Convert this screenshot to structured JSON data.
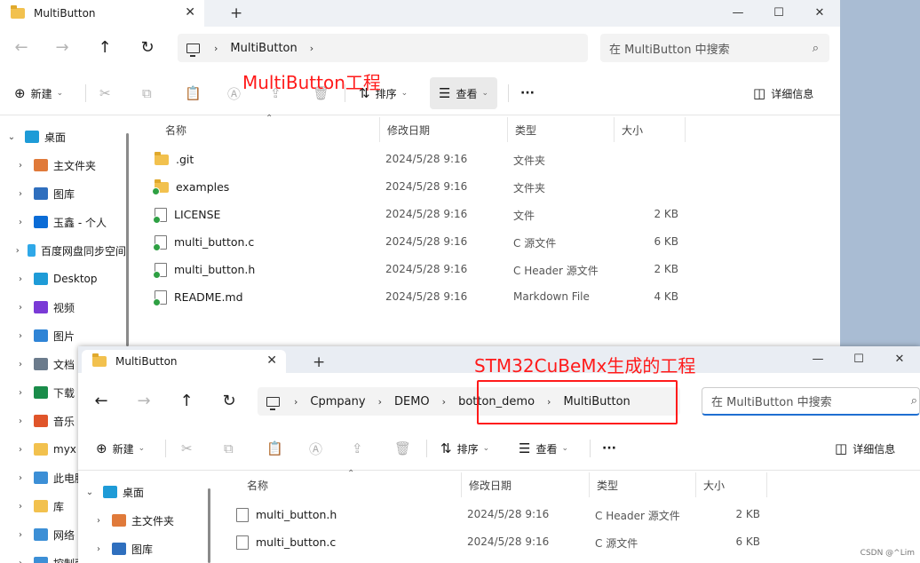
{
  "window1": {
    "tab_title": "MultiButton",
    "nav": {
      "back": "←",
      "forward": "→",
      "up": "↑",
      "refresh": "↻"
    },
    "address": {
      "crumbs": [
        "MultiButton"
      ],
      "trailing_chevron": "›"
    },
    "search_placeholder": "在 MultiButton 中搜索",
    "toolbar": {
      "new_label": "新建",
      "sort_label": "排序",
      "view_label": "查看",
      "more_label": "···",
      "details_label": "详细信息"
    },
    "columns": {
      "name": "名称",
      "date": "修改日期",
      "type": "类型",
      "size": "大小"
    },
    "files": [
      {
        "name": ".git",
        "date": "2024/5/28 9:16",
        "type": "文件夹",
        "size": "",
        "kind": "folder",
        "synced": false
      },
      {
        "name": "examples",
        "date": "2024/5/28 9:16",
        "type": "文件夹",
        "size": "",
        "kind": "folder",
        "synced": true
      },
      {
        "name": "LICENSE",
        "date": "2024/5/28 9:16",
        "type": "文件",
        "size": "2 KB",
        "kind": "file",
        "synced": true
      },
      {
        "name": "multi_button.c",
        "date": "2024/5/28 9:16",
        "type": "C 源文件",
        "size": "6 KB",
        "kind": "file",
        "synced": true
      },
      {
        "name": "multi_button.h",
        "date": "2024/5/28 9:16",
        "type": "C Header 源文件",
        "size": "2 KB",
        "kind": "file",
        "synced": true
      },
      {
        "name": "README.md",
        "date": "2024/5/28 9:16",
        "type": "Markdown File",
        "size": "4 KB",
        "kind": "file",
        "synced": true
      }
    ],
    "sidebar": [
      {
        "label": "桌面",
        "expanded": true,
        "color": "#1e9bd7"
      },
      {
        "label": "主文件夹",
        "expanded": false,
        "color": "#e07a3a"
      },
      {
        "label": "图库",
        "expanded": false,
        "color": "#2f6fbe"
      },
      {
        "label": "玉鑫 - 个人",
        "expanded": false,
        "color": "#0b6cd6"
      },
      {
        "label": "百度网盘同步空间",
        "expanded": false,
        "color": "#2fa8e8"
      },
      {
        "label": "Desktop",
        "expanded": false,
        "color": "#1e9bd7"
      },
      {
        "label": "视频",
        "expanded": false,
        "color": "#7a3ad6"
      },
      {
        "label": "图片",
        "expanded": false,
        "color": "#2f84d6"
      },
      {
        "label": "文档",
        "expanded": false,
        "color": "#6b7b8c"
      },
      {
        "label": "下载",
        "expanded": false,
        "color": "#1a8c4a"
      },
      {
        "label": "音乐",
        "expanded": false,
        "color": "#e0552a"
      },
      {
        "label": "myx",
        "expanded": false,
        "color": "#f2c14e"
      },
      {
        "label": "此电脑",
        "expanded": false,
        "color": "#3c8fd6"
      },
      {
        "label": "库",
        "expanded": false,
        "color": "#f2c14e"
      },
      {
        "label": "网络",
        "expanded": false,
        "color": "#3c8fd6"
      },
      {
        "label": "控制面板",
        "expanded": false,
        "color": "#3c8fd6"
      }
    ]
  },
  "window2": {
    "tab_title": "MultiButton",
    "address": {
      "crumbs": [
        "Cpmpany",
        "DEMO",
        "botton_demo",
        "MultiButton"
      ]
    },
    "search_placeholder": "在 MultiButton 中搜索",
    "toolbar": {
      "new_label": "新建",
      "sort_label": "排序",
      "view_label": "查看",
      "more_label": "···",
      "details_label": "详细信息"
    },
    "columns": {
      "name": "名称",
      "date": "修改日期",
      "type": "类型",
      "size": "大小"
    },
    "files": [
      {
        "name": "multi_button.h",
        "date": "2024/5/28 9:16",
        "type": "C Header 源文件",
        "size": "2 KB"
      },
      {
        "name": "multi_button.c",
        "date": "2024/5/28 9:16",
        "type": "C 源文件",
        "size": "6 KB"
      }
    ],
    "sidebar": [
      {
        "label": "桌面",
        "color": "#1e9bd7"
      },
      {
        "label": "主文件夹",
        "color": "#e07a3a"
      },
      {
        "label": "图库",
        "color": "#2f6fbe"
      }
    ]
  },
  "annotations": {
    "top": "MultiButton工程",
    "bottom": "STM32CuBeMx生成的工程"
  },
  "watermark": "CSDN @^Lim",
  "accent_color": "#ff1a1a"
}
